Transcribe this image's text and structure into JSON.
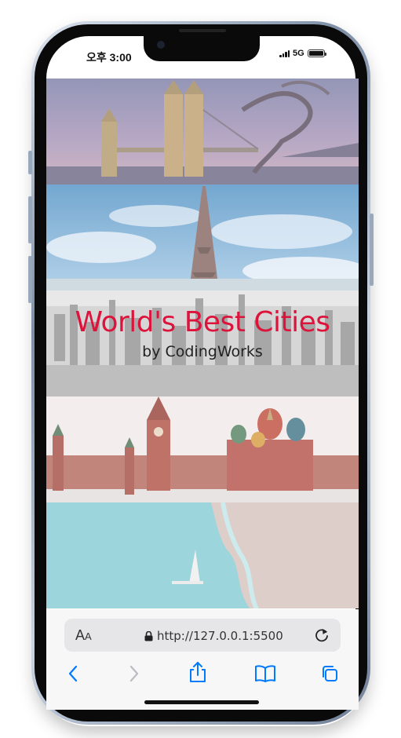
{
  "status_bar": {
    "time": "오후 3:00",
    "network": "5G"
  },
  "hero": {
    "title": "World's Best Cities",
    "subtitle": "by CodingWorks"
  },
  "browser": {
    "text_size_big": "A",
    "text_size_small": "A",
    "url": "http://127.0.0.1:5500"
  },
  "colors": {
    "accent": "#dc143c",
    "ios_blue": "#007aff"
  },
  "icons": [
    "lock-icon",
    "reload-icon",
    "back-icon",
    "forward-icon",
    "share-icon",
    "bookmarks-icon",
    "tabs-icon"
  ]
}
